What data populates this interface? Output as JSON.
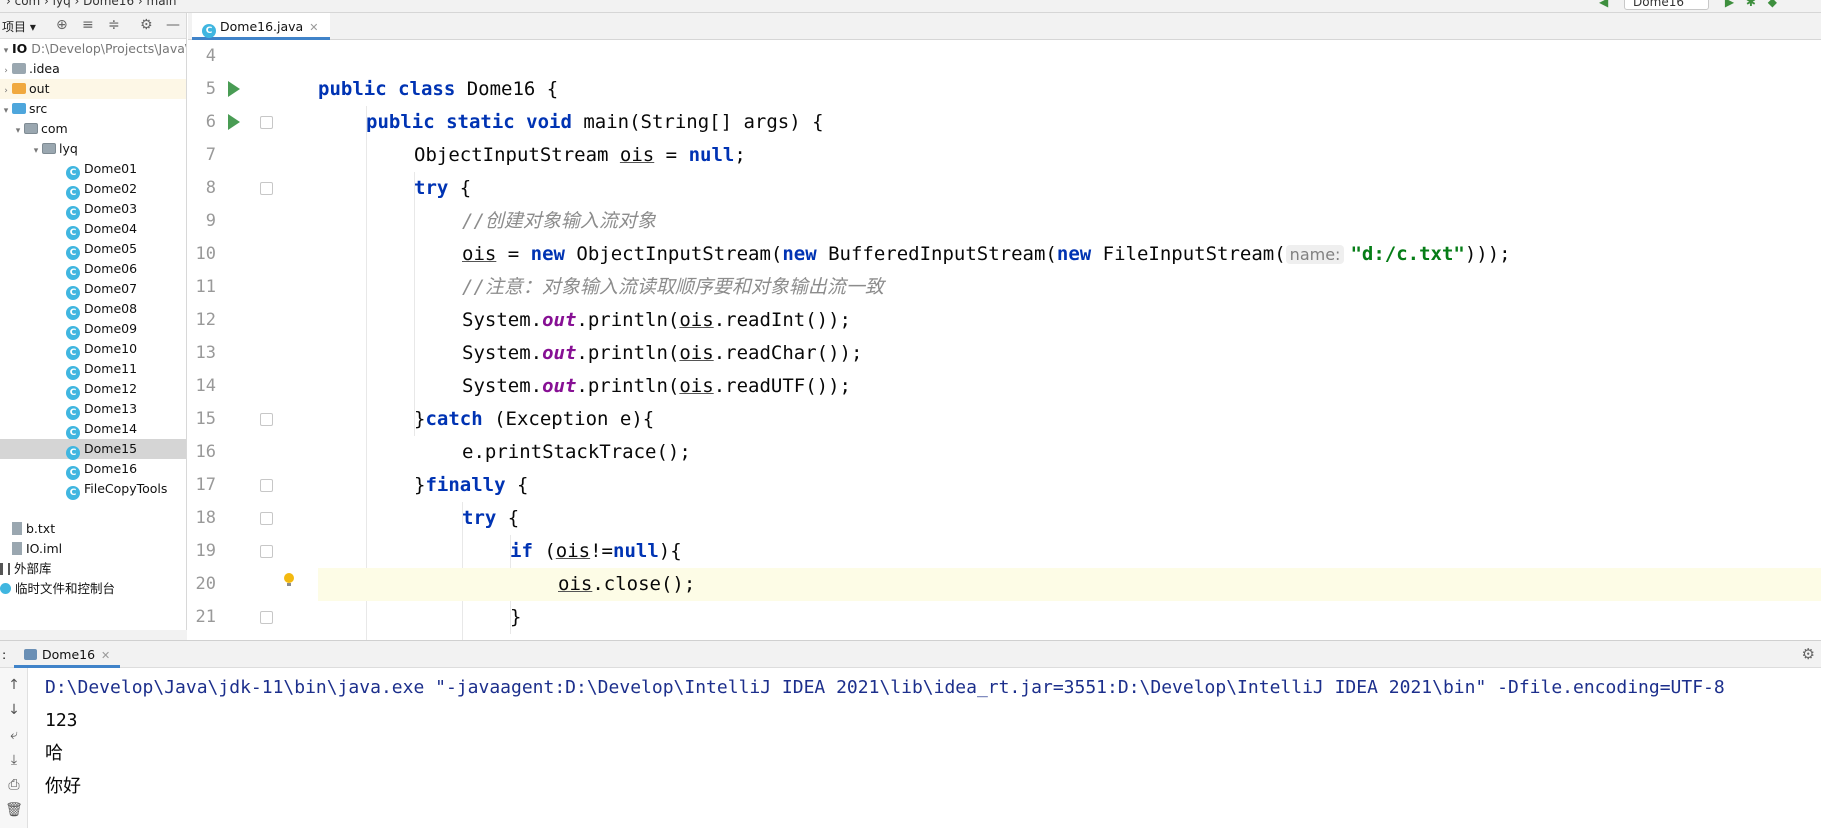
{
  "topbar": {
    "breadcrumb": "› com › lyq › Dome16 › main",
    "run_config": "Dome16"
  },
  "project": {
    "toolbar_label": "项目",
    "root_name": "IO",
    "root_path": "D:\\Develop\\Projects\\Java\\I",
    "folders": {
      "idea": ".idea",
      "out": "out",
      "src": "src",
      "com": "com",
      "lyq": "lyq"
    },
    "classes": [
      "Dome01",
      "Dome02",
      "Dome03",
      "Dome04",
      "Dome05",
      "Dome06",
      "Dome07",
      "Dome08",
      "Dome09",
      "Dome10",
      "Dome11",
      "Dome12",
      "Dome13",
      "Dome14",
      "Dome15",
      "Dome16",
      "FileCopyTools"
    ],
    "selected_class": "Dome15",
    "files": [
      "b.txt",
      "IO.iml"
    ],
    "external_libs": "外部库",
    "scratches": "临时文件和控制台"
  },
  "editor": {
    "tab_label": "Dome16.java",
    "line_numbers": [
      "4",
      "5",
      "6",
      "7",
      "8",
      "9",
      "10",
      "11",
      "12",
      "13",
      "14",
      "15",
      "16",
      "17",
      "18",
      "19",
      "20",
      "21"
    ],
    "code": {
      "l5_a": "public class",
      "l5_b": " Dome16 {",
      "l6_a": "public static void",
      "l6_b": " main(String[] args) {",
      "l7_a": "ObjectInputStream ",
      "l7_var": "ois",
      "l7_b": " = ",
      "l7_null": "null",
      "l7_c": ";",
      "l8_kw": "try",
      "l8_b": " {",
      "l9_comment": "//创建对象输入流对象",
      "l10_var": "ois",
      "l10_a": " = ",
      "l10_new1": "new",
      "l10_b": " ObjectInputStream(",
      "l10_new2": "new",
      "l10_c": " BufferedInputStream(",
      "l10_new3": "new",
      "l10_d": " FileInputStream(",
      "l10_hint": "name:",
      "l10_str": "\"d:/c.txt\"",
      "l10_e": ")));",
      "l11_comment": "//注意：对象输入流读取顺序要和对象输出流一致",
      "sys": "System.",
      "out": "out",
      "println": ".println(",
      "ois": "ois",
      "l12_m": ".readInt());",
      "l13_m": ".readChar());",
      "l14_m": ".readUTF());",
      "l15_a": "}",
      "l15_kw": "catch",
      "l15_b": " (Exception e){",
      "l16": "e.printStackTrace();",
      "l17_a": "}",
      "l17_kw": "finally",
      "l17_b": " {",
      "l18_kw": "try",
      "l18_b": " {",
      "l19_kw": "if",
      "l19_a": " (",
      "l19_var": "ois",
      "l19_b": "!=",
      "l19_null": "null",
      "l19_c": "){",
      "l20_var": "ois",
      "l20_a": ".close();",
      "l21": "}"
    }
  },
  "run": {
    "colon": ":",
    "tab_label": "Dome16",
    "console_lines": [
      "D:\\Develop\\Java\\jdk-11\\bin\\java.exe \"-javaagent:D:\\Develop\\IntelliJ IDEA 2021\\lib\\idea_rt.jar=3551:D:\\Develop\\IntelliJ IDEA 2021\\bin\" -Dfile.encoding=UTF-8",
      "123",
      "哈",
      "你好"
    ]
  }
}
